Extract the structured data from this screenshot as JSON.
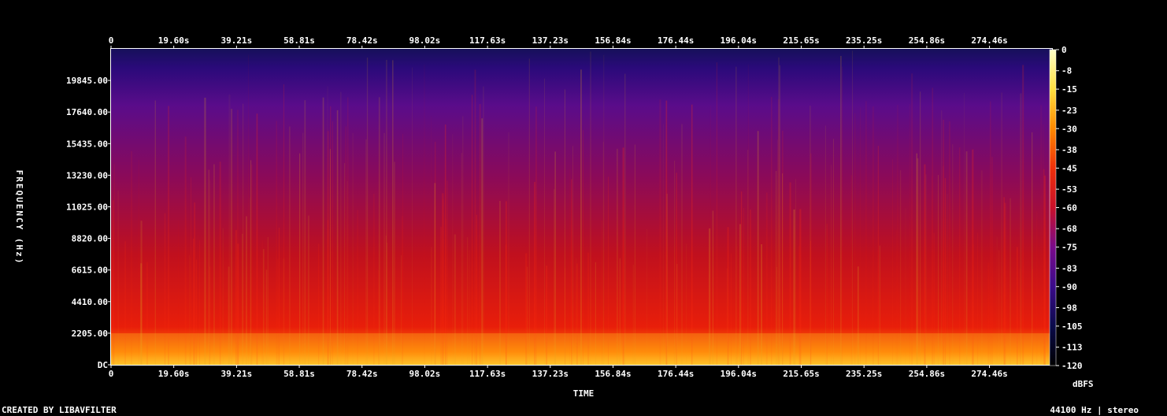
{
  "chart_data": {
    "type": "heatmap",
    "title": "",
    "xlabel": "TIME",
    "ylabel": "FREQUENCY (Hz)",
    "x_ticks": [
      "0",
      "19.60s",
      "39.21s",
      "58.81s",
      "78.42s",
      "98.02s",
      "117.63s",
      "137.23s",
      "156.84s",
      "176.44s",
      "196.04s",
      "215.65s",
      "235.25s",
      "254.86s",
      "274.46s"
    ],
    "x_tick_values": [
      0,
      19.6,
      39.21,
      58.81,
      78.42,
      98.02,
      117.63,
      137.23,
      156.84,
      176.44,
      196.04,
      215.65,
      235.25,
      254.86,
      274.46
    ],
    "xlim": [
      0,
      294
    ],
    "y_ticks": [
      "DC",
      "2205.00",
      "4410.00",
      "6615.00",
      "8820.00",
      "11025.00",
      "13230.00",
      "15435.00",
      "17640.00",
      "19845.00"
    ],
    "y_tick_values": [
      0,
      2205,
      4410,
      6615,
      8820,
      11025,
      13230,
      15435,
      17640,
      19845
    ],
    "ylim": [
      0,
      22050
    ],
    "colorbar": {
      "label": "dBFS",
      "ticks": [
        "0",
        "-8",
        "-15",
        "-23",
        "-30",
        "-38",
        "-45",
        "-53",
        "-60",
        "-68",
        "-75",
        "-83",
        "-90",
        "-98",
        "-105",
        "-113",
        "-120"
      ],
      "range": [
        -120,
        0
      ],
      "colormap_stops": [
        "#000000",
        "#0a0a4a",
        "#3a0a8a",
        "#7a0a8a",
        "#c8102a",
        "#f0300a",
        "#ff8a00",
        "#ffe040",
        "#ffffc8"
      ]
    },
    "grid": false
  },
  "footer": {
    "left": "CREATED BY LIBAVFILTER",
    "right": "44100 Hz | stereo"
  }
}
